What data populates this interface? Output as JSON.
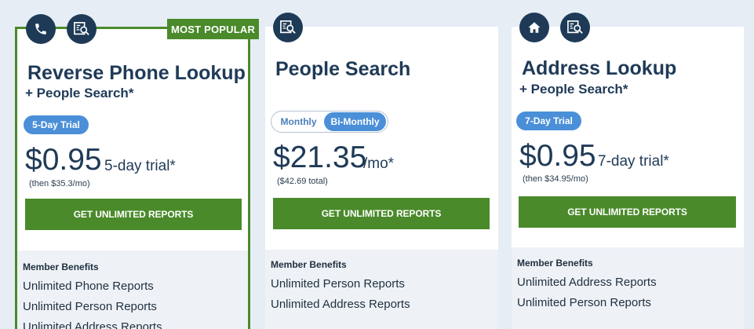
{
  "plans": [
    {
      "badge": "MOST POPULAR",
      "icons": [
        "phone-icon",
        "search-report-icon"
      ],
      "title": "Reverse Phone Lookup",
      "subtitle": "+ People Search*",
      "trial_pill": "5-Day Trial",
      "price": "$0.95",
      "price_suffix": "5-day trial*",
      "price_note": "(then $35.3/mo)",
      "cta": "GET UNLIMITED REPORTS",
      "benefits_title": "Member Benefits",
      "benefits": [
        "Unlimited Phone Reports",
        "Unlimited Person Reports",
        "Unlimited Address Reports"
      ]
    },
    {
      "icons": [
        "search-report-icon"
      ],
      "title": "People Search",
      "toggle": {
        "options": [
          "Monthly",
          "Bi-Monthly"
        ],
        "selected": "Bi-Monthly"
      },
      "price": "$21.35",
      "price_suffix": "/mo*",
      "price_note": "($42.69 total)",
      "cta": "GET UNLIMITED REPORTS",
      "benefits_title": "Member Benefits",
      "benefits": [
        "Unlimited Person Reports",
        "Unlimited Address Reports"
      ]
    },
    {
      "icons": [
        "home-icon",
        "search-report-icon"
      ],
      "title": "Address Lookup",
      "subtitle": "+ People Search*",
      "trial_pill": "7-Day Trial",
      "price": "$0.95",
      "price_suffix": "7-day trial*",
      "price_note": "(then $34.95/mo)",
      "cta": "GET UNLIMITED REPORTS",
      "benefits_title": "Member Benefits",
      "benefits": [
        "Unlimited Address Reports",
        "Unlimited Person Reports"
      ]
    }
  ],
  "colors": {
    "accent_green": "#4a8a2a",
    "navy": "#1f3a57",
    "pill_blue": "#4a8fd8",
    "page_bg": "#e6edf5"
  }
}
